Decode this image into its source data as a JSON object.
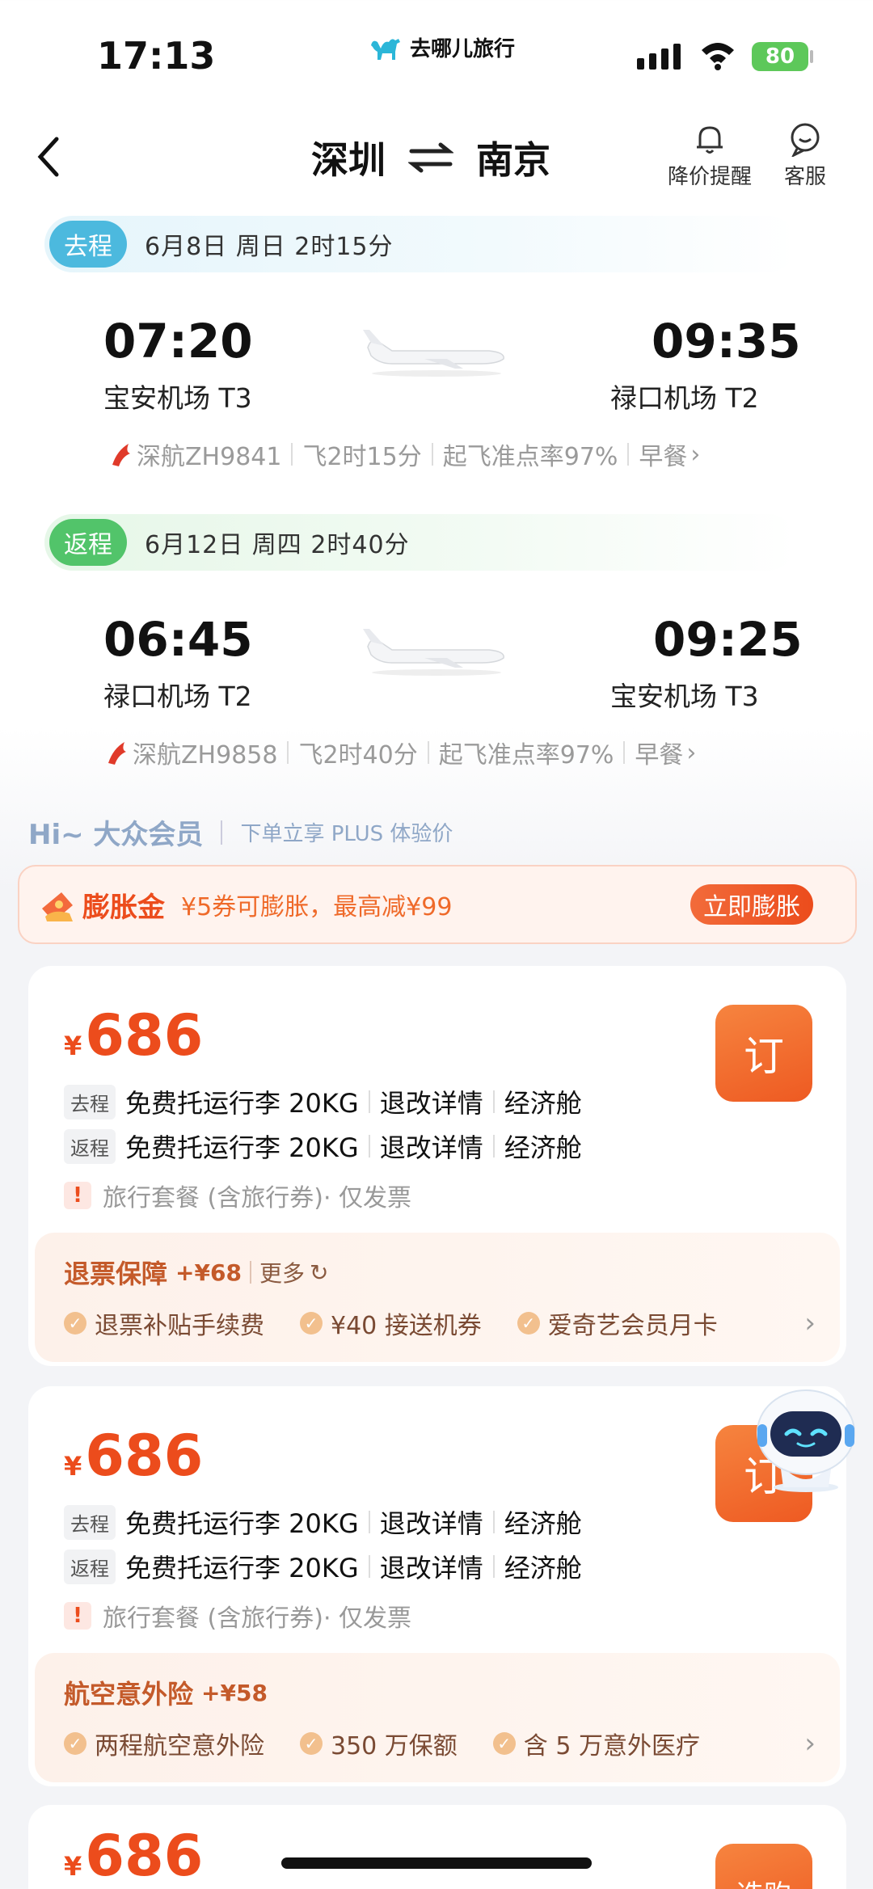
{
  "status": {
    "time": "17:13",
    "brand": "去哪儿旅行",
    "battery": "80"
  },
  "nav": {
    "from": "深圳",
    "to": "南京",
    "price_alert": "降价提醒",
    "service": "客服"
  },
  "outbound": {
    "tag": "去程",
    "info": "6月8日 周日  2时15分",
    "dep_time": "07:20",
    "dep_airport": "宝安机场 T3",
    "arr_time": "09:35",
    "arr_airport": "禄口机场 T2",
    "flight": "深航ZH9841",
    "duration": "飞2时15分",
    "ontime": "起飞准点率97%",
    "meal": "早餐"
  },
  "return": {
    "tag": "返程",
    "info": "6月12日 周四  2时40分",
    "dep_time": "06:45",
    "dep_airport": "禄口机场 T2",
    "arr_time": "09:25",
    "arr_airport": "宝安机场 T3",
    "flight": "深航ZH9858",
    "duration": "飞2时40分",
    "ontime": "起飞准点率97%",
    "meal": "早餐"
  },
  "member": {
    "hi": "Hi~ 大众会员",
    "sub": "下单立享 PLUS 体验价"
  },
  "expand": {
    "title": "膨胀金",
    "desc": "¥5券可膨胀，最高减¥99",
    "button": "立即膨胀"
  },
  "cards": [
    {
      "currency": "¥",
      "price": "686",
      "book": "订",
      "out_tag": "去程",
      "ret_tag": "返程",
      "baggage": "免费托运行李 20KG",
      "refund": "退改详情",
      "cabin": "经济舱",
      "notice": "旅行套餐 (含旅行券)· 仅发票",
      "panel_title": "退票保障",
      "panel_price": "+¥68",
      "panel_more": "更多",
      "feats": [
        "退票补贴手续费",
        "¥40 接送机券",
        "爱奇艺会员月卡"
      ]
    },
    {
      "currency": "¥",
      "price": "686",
      "book": "订",
      "out_tag": "去程",
      "ret_tag": "返程",
      "baggage": "免费托运行李 20KG",
      "refund": "退改详情",
      "cabin": "经济舱",
      "notice": "旅行套餐 (含旅行券)· 仅发票",
      "panel_title": "航空意外险",
      "panel_price": "+¥58",
      "feats": [
        "两程航空意外险",
        "350 万保额",
        "含 5 万意外医疗"
      ]
    },
    {
      "currency": "¥",
      "price": "686",
      "book": "选购"
    }
  ]
}
